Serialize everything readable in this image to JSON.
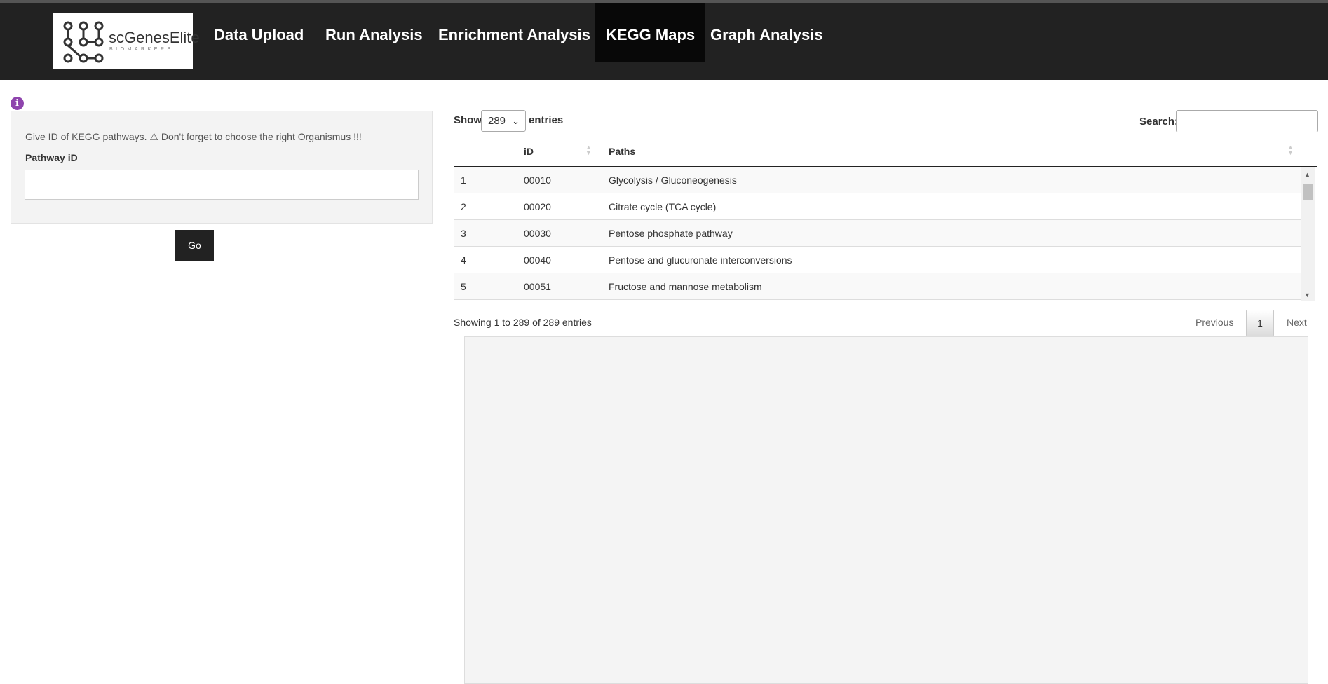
{
  "brand": {
    "name": "scGenesElite",
    "subtitle": "BIOMARKERS"
  },
  "nav": {
    "items": [
      {
        "label": "Data Upload",
        "active": false
      },
      {
        "label": "Run Analysis",
        "active": false
      },
      {
        "label": "Enrichment Analysis",
        "active": false
      },
      {
        "label": "KEGG Maps",
        "active": true
      },
      {
        "label": "Graph Analysis",
        "active": false
      }
    ]
  },
  "left_panel": {
    "info_icon": "info-circle-icon",
    "help_text": "Give ID of KEGG pathways. ⚠ Don't forget to choose the right Organismus !!!",
    "field_label": "Pathway iD",
    "field_value": "",
    "go_label": "Go"
  },
  "table": {
    "show_label": "Show",
    "page_length": "289",
    "entries_label": "entries",
    "search_label": "Search:",
    "search_value": "",
    "columns": [
      "",
      "iD",
      "Paths"
    ],
    "rows": [
      {
        "n": "1",
        "id": "00010",
        "path": "Glycolysis / Gluconeogenesis"
      },
      {
        "n": "2",
        "id": "00020",
        "path": "Citrate cycle (TCA cycle)"
      },
      {
        "n": "3",
        "id": "00030",
        "path": "Pentose phosphate pathway"
      },
      {
        "n": "4",
        "id": "00040",
        "path": "Pentose and glucuronate interconversions"
      },
      {
        "n": "5",
        "id": "00051",
        "path": "Fructose and mannose metabolism"
      }
    ],
    "info": "Showing 1 to 289 of 289 entries",
    "pagination": {
      "previous": "Previous",
      "current": "1",
      "next": "Next"
    }
  },
  "colors": {
    "navbar": "#222222",
    "active_nav": "#080808",
    "info_icon": "#8e44ad",
    "go_button": "#222222"
  }
}
